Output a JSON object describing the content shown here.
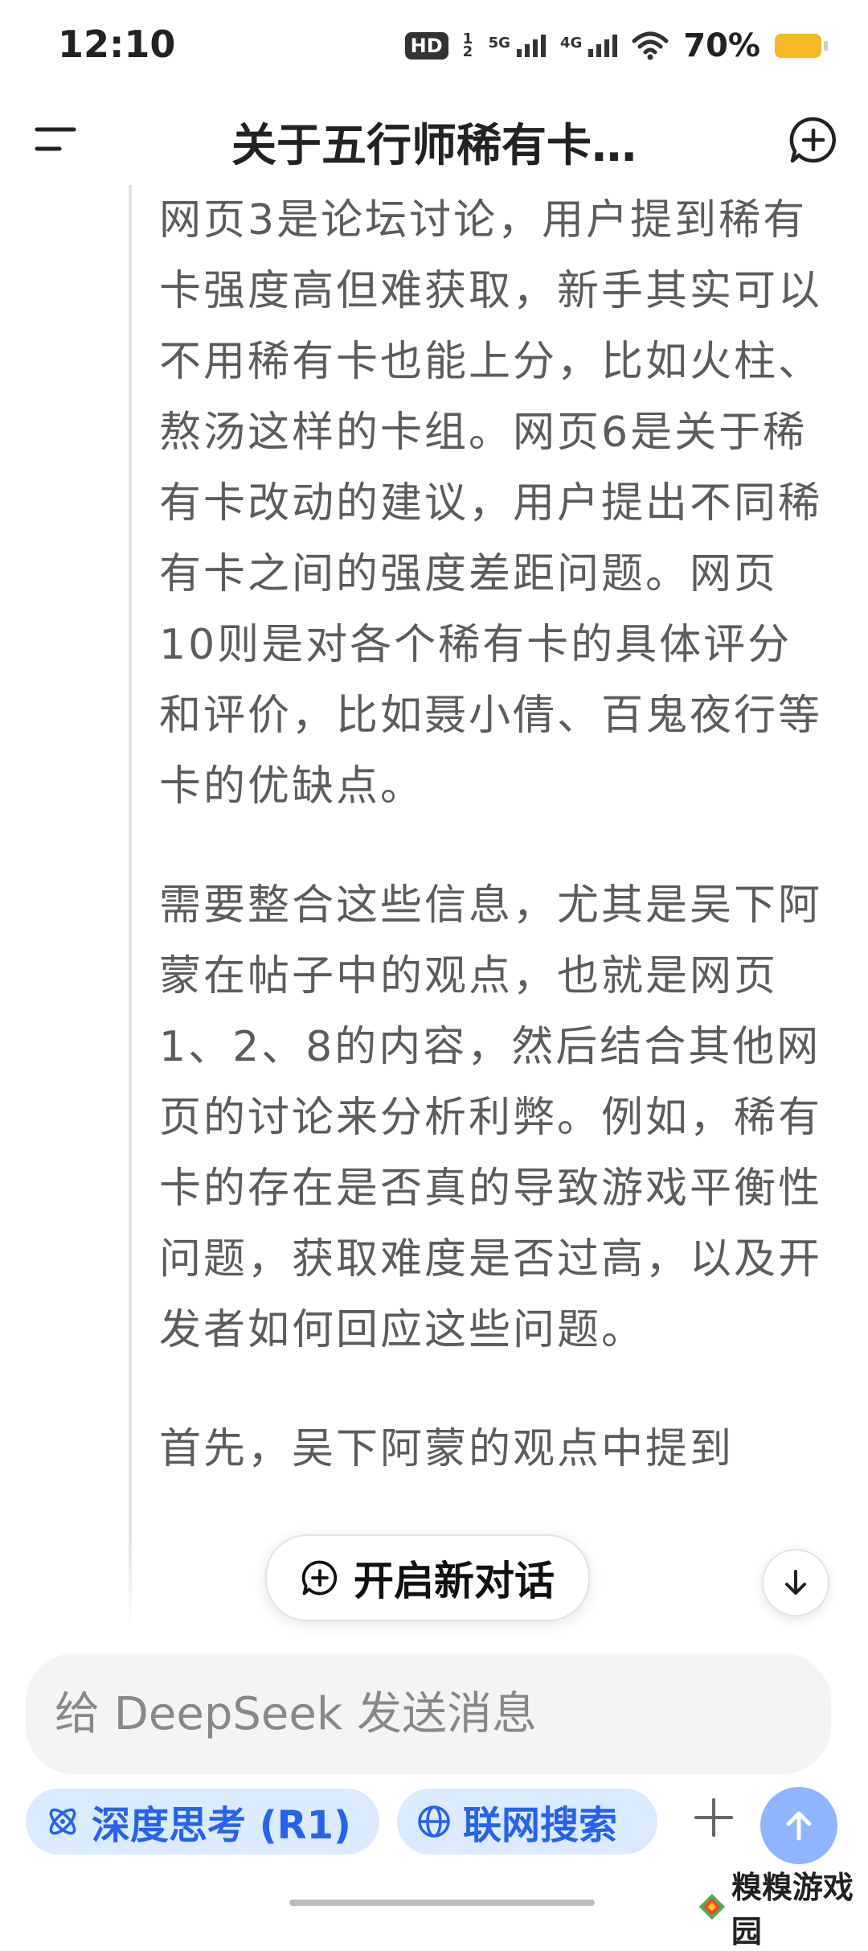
{
  "status_bar": {
    "time": "12:10",
    "hd_label": "HD",
    "hd_sub": "1 2",
    "net1": "5G",
    "net2": "4G",
    "battery_percent": "70%",
    "battery_color": "#f7b924"
  },
  "header": {
    "title": "关于五行师稀有卡…",
    "menu_icon": "menu-icon",
    "new_chat_icon": "new-chat-icon"
  },
  "thinking": {
    "paragraphs": [
      "网页3是论坛讨论，用户提到稀有卡强度高但难获取，新手其实可以不用稀有卡也能上分，比如火柱、熬汤这样的卡组。网页6是关于稀有卡改动的建议，用户提出不同稀有卡之间的强度差距问题。网页10则是对各个稀有卡的具体评分和评价，比如聂小倩、百鬼夜行等卡的优缺点。",
      "需要整合这些信息，尤其是吴下阿蒙在帖子中的观点，也就是网页1、2、8的内容，然后结合其他网页的讨论来分析利弊。例如，稀有卡的存在是否真的导致游戏平衡性问题，获取难度是否过高，以及开发者如何回应这些问题。",
      "首先，吴下阿蒙的观点中提到"
    ]
  },
  "floating": {
    "new_dialog_label": "开启新对话"
  },
  "input": {
    "placeholder": "给 DeepSeek 发送消息"
  },
  "toolbar": {
    "deep_think_label": "深度思考 (R1)",
    "web_search_label": "联网搜索",
    "accent_color": "#2563eb",
    "pill_bg": "#dbeafe"
  },
  "watermark": {
    "text": "糗糗游戏园"
  }
}
